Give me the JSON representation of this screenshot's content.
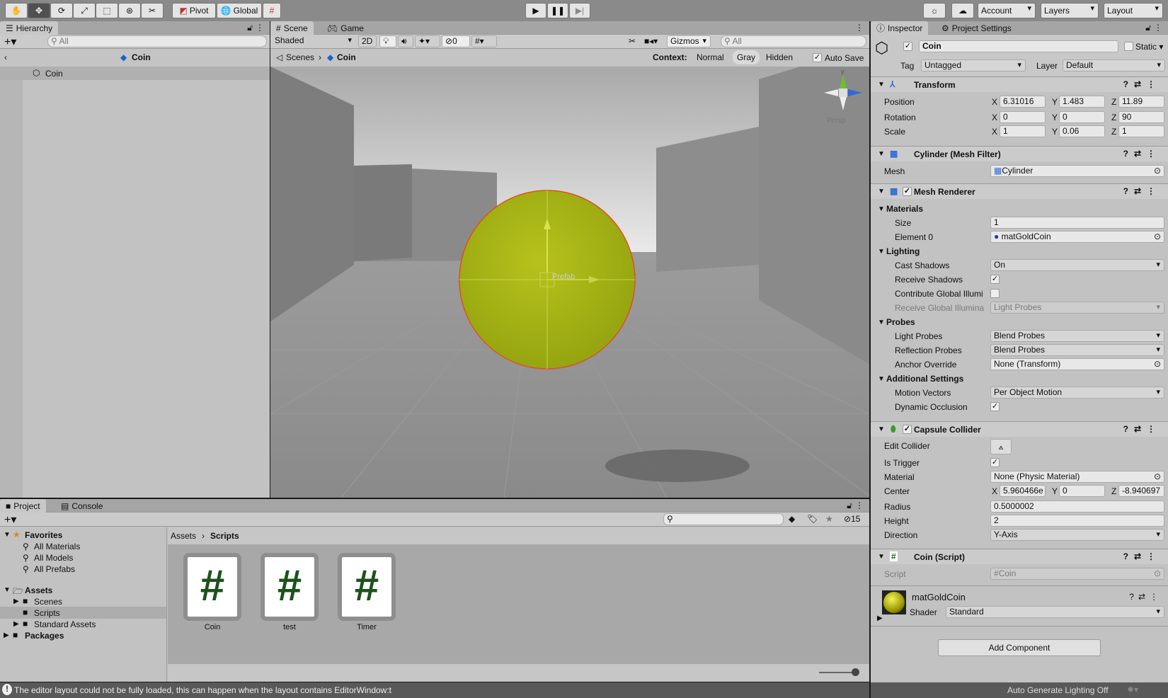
{
  "toolbar": {
    "tools": [
      "hand-tool",
      "move-tool",
      "rotate-tool",
      "scale-tool",
      "rect-tool",
      "transform-tool",
      "custom-tool"
    ],
    "pivot": "Pivot",
    "global": "Global",
    "account": "Account",
    "layers": "Layers",
    "layout": "Layout"
  },
  "hierarchy": {
    "tab": "Hierarchy",
    "search_placeholder": "All",
    "breadcrumb": "Coin",
    "items": [
      "Coin"
    ]
  },
  "scene": {
    "tabs": [
      "Scene",
      "Game"
    ],
    "shading": "Shaded",
    "mode_2d": "2D",
    "hidden_count": "0",
    "gizmos": "Gizmos",
    "search_placeholder": "All",
    "breadcrumb": [
      "Scenes",
      "Coin"
    ],
    "context_label": "Context:",
    "context_options": [
      "Normal",
      "Gray",
      "Hidden"
    ],
    "context_selected": "Gray",
    "auto_save": "Auto Save",
    "auto_save_checked": true,
    "prefab_label": "Prefab",
    "persp": "Persp",
    "gizmo_axis": "y",
    "coin_color": "#a3b214"
  },
  "inspector": {
    "tabs": [
      "Inspector",
      "Project Settings"
    ],
    "object_name": "Coin",
    "active": true,
    "static": "Static",
    "tag_label": "Tag",
    "tag": "Untagged",
    "layer_label": "Layer",
    "layer": "Default",
    "transform": {
      "title": "Transform",
      "rows": [
        {
          "label": "Position",
          "x": "6.31016",
          "y": "1.483",
          "z": "11.89"
        },
        {
          "label": "Rotation",
          "x": "0",
          "y": "0",
          "z": "90"
        },
        {
          "label": "Scale",
          "x": "1",
          "y": "0.06",
          "z": "1"
        }
      ]
    },
    "mesh_filter": {
      "title": "Cylinder (Mesh Filter)",
      "mesh_label": "Mesh",
      "mesh": "Cylinder"
    },
    "mesh_renderer": {
      "title": "Mesh Renderer",
      "materials": "Materials",
      "size_label": "Size",
      "size": "1",
      "element0_label": "Element 0",
      "element0": "matGoldCoin",
      "lighting": "Lighting",
      "cast_shadows_label": "Cast Shadows",
      "cast_shadows": "On",
      "receive_shadows_label": "Receive Shadows",
      "contribute_gi_label": "Contribute Global Illumi",
      "receive_gi_label": "Receive Global Illumina",
      "receive_gi": "Light Probes",
      "probes": "Probes",
      "light_probes_label": "Light Probes",
      "light_probes": "Blend Probes",
      "reflection_probes_label": "Reflection Probes",
      "reflection_probes": "Blend Probes",
      "anchor_override_label": "Anchor Override",
      "anchor_override": "None (Transform)",
      "additional": "Additional Settings",
      "motion_vectors_label": "Motion Vectors",
      "motion_vectors": "Per Object Motion",
      "dynamic_occlusion_label": "Dynamic Occlusion"
    },
    "capsule_collider": {
      "title": "Capsule Collider",
      "edit_collider_label": "Edit Collider",
      "is_trigger_label": "Is Trigger",
      "material_label": "Material",
      "material": "None (Physic Material)",
      "center_label": "Center",
      "center_x": "5.960466e",
      "center_y": "0",
      "center_z": "-8.940697",
      "radius_label": "Radius",
      "radius": "0.5000002",
      "height_label": "Height",
      "height": "2",
      "direction_label": "Direction",
      "direction": "Y-Axis"
    },
    "coin_script": {
      "title": "Coin (Script)",
      "script_label": "Script",
      "script": "Coin"
    },
    "material": {
      "name": "matGoldCoin",
      "shader_label": "Shader",
      "shader": "Standard"
    },
    "add_component": "Add Component"
  },
  "project": {
    "tabs": [
      "Project",
      "Console"
    ],
    "hidden_count": "15",
    "favorites": "Favorites",
    "favorite_items": [
      "All Materials",
      "All Models",
      "All Prefabs"
    ],
    "assets": "Assets",
    "asset_folders": [
      "Scenes",
      "Scripts",
      "Standard Assets"
    ],
    "packages": "Packages",
    "breadcrumb": [
      "Assets",
      "Scripts"
    ],
    "files": [
      "Coin",
      "test",
      "Timer"
    ]
  },
  "status": {
    "message": "The editor layout could not be fully loaded, this can happen when the layout contains EditorWindow:t",
    "lighting": "Auto Generate Lighting Off"
  }
}
